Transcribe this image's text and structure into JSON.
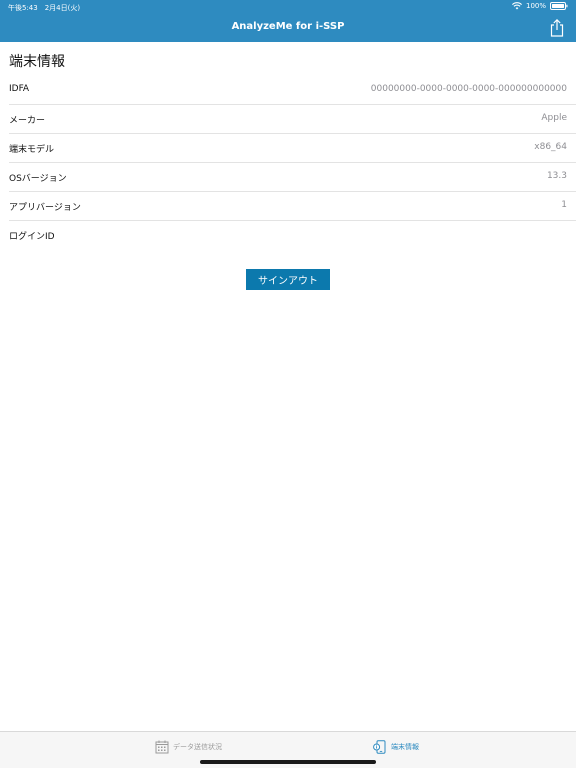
{
  "status_bar": {
    "time_date": "午後5:43　2月4日(火)",
    "battery": "100%"
  },
  "nav": {
    "title": "AnalyzeMe for i-SSP"
  },
  "section": {
    "title": "端末情報"
  },
  "info_rows": [
    {
      "label": "IDFA",
      "value": "00000000-0000-0000-0000-000000000000"
    },
    {
      "label": "メーカー",
      "value": "Apple"
    },
    {
      "label": "端末モデル",
      "value": "x86_64"
    },
    {
      "label": "OSバージョン",
      "value": "13.3"
    },
    {
      "label": "アプリバージョン",
      "value": "1"
    },
    {
      "label": "ログインID",
      "value": ""
    }
  ],
  "signout": {
    "label": "サインアウト"
  },
  "tabs": [
    {
      "label": "データ送信状況",
      "icon": "calendar-icon",
      "selected": false
    },
    {
      "label": "端末情報",
      "icon": "device-info-icon",
      "selected": true
    }
  ],
  "colors": {
    "header": "#2e8bc0",
    "button": "#0c79ad",
    "tab_selected": "#2e8bc0",
    "tab_unselected": "#9a9a9a"
  }
}
